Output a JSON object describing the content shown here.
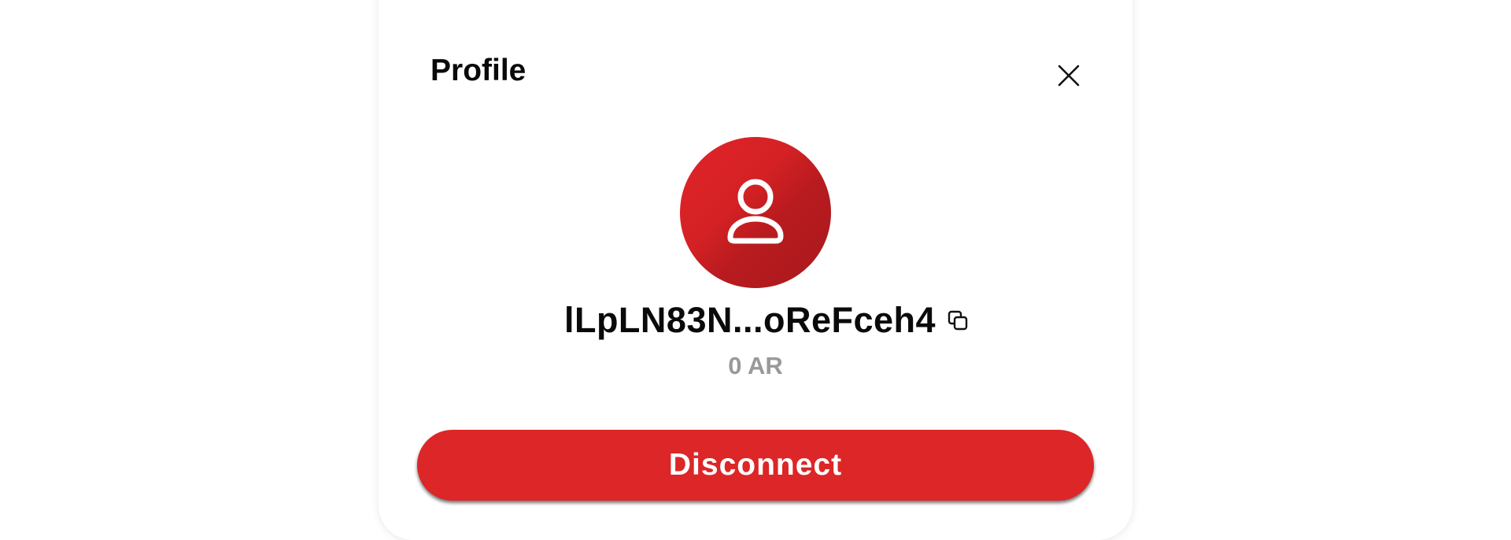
{
  "modal": {
    "title": "Profile",
    "close_icon": "close-icon",
    "avatar_icon": "user-icon",
    "address": "lLpLN83N...oReFceh4",
    "copy_icon": "copy-icon",
    "balance": "0 AR",
    "disconnect_label": "Disconnect"
  },
  "colors": {
    "accent": "#dc2627",
    "balance_text": "#999999"
  }
}
